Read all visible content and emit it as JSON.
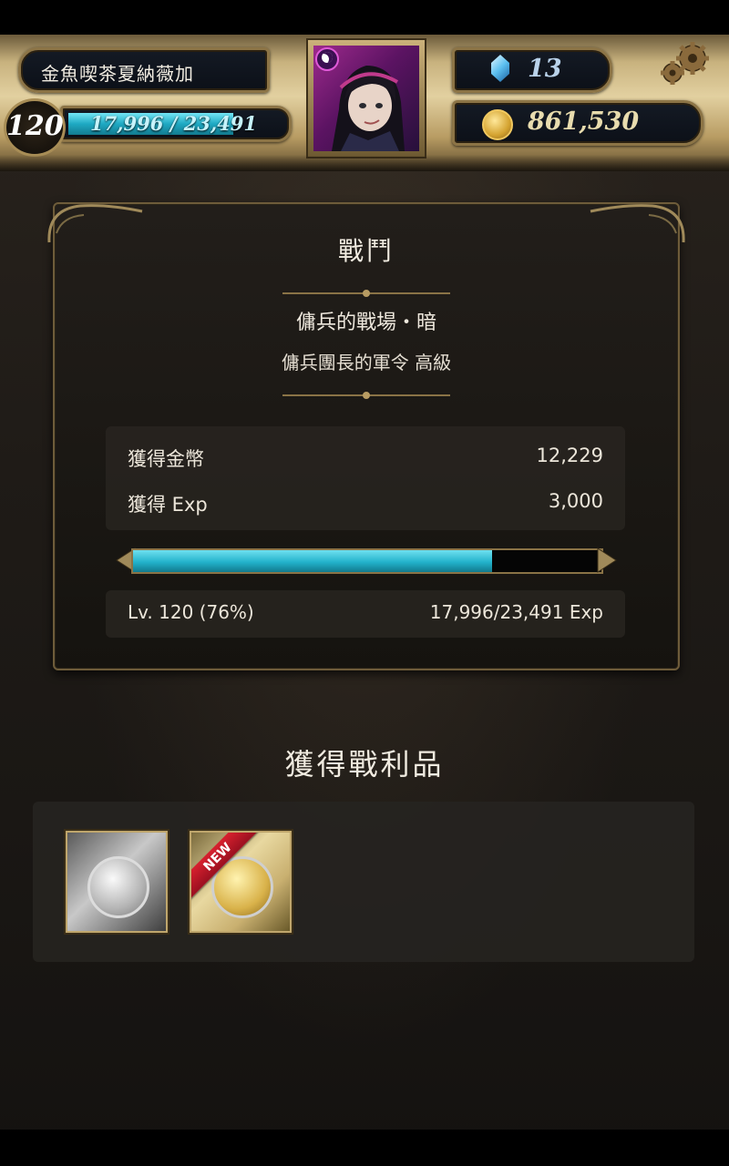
{
  "player": {
    "name": "金魚喫茶夏納薇加",
    "level": "120",
    "exp_text": "17,996 / 23,491",
    "exp_fraction": 0.766
  },
  "currency": {
    "gems": "13",
    "coins": "861,530"
  },
  "battle": {
    "title": "戰鬥",
    "stage_name": "傭兵的戰場・暗",
    "stage_sub": "傭兵團長的軍令 高級",
    "rewards": [
      {
        "label": "獲得金幣",
        "value": "12,229"
      },
      {
        "label": "獲得 Exp",
        "value": "3,000"
      }
    ],
    "exp_fraction": 0.766,
    "level_text": "Lv. 120 (76%)",
    "exp_detail": "17,996/23,491 Exp"
  },
  "loot": {
    "title": "獲得戰利品",
    "items": [
      {
        "icon": "silver-medal-card-icon"
      },
      {
        "icon": "gold-medal-card-icon",
        "badge": "NEW"
      }
    ]
  },
  "colors": {
    "exp_bar": "#22b2cb",
    "frame_gold": "#bfa66c",
    "new_ribbon": "#d8202e"
  }
}
